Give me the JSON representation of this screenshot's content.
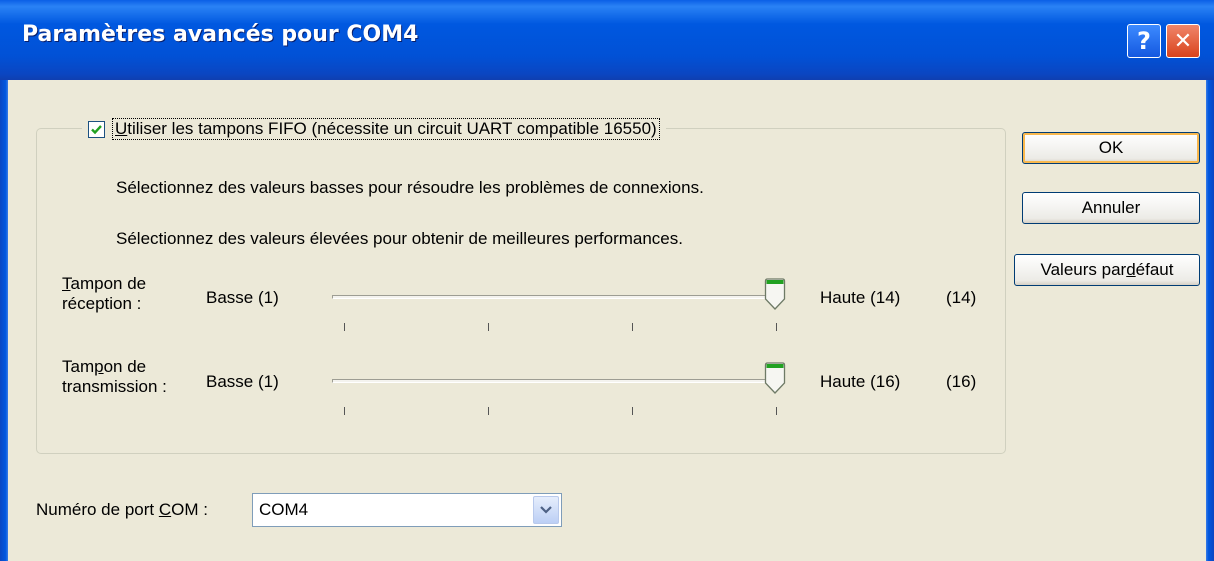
{
  "window": {
    "title": "Paramètres avancés pour COM4",
    "help_glyph": "?",
    "close_glyph": "✕"
  },
  "fifo": {
    "checked": true,
    "label": "Utiliser les tampons FIFO (nécessite un circuit UART compatible 16550)",
    "hint_low": "Sélectionnez des valeurs basses pour résoudre les problèmes de connexions.",
    "hint_high": "Sélectionnez des valeurs élevées pour obtenir de meilleures performances."
  },
  "receive": {
    "label_line1": "Tampon de",
    "label_line2": "réception :",
    "min_label": "Basse (1)",
    "max_label": "Haute (14)",
    "current": "(14)",
    "value": 14,
    "min": 1,
    "max": 14
  },
  "transmit": {
    "label_line1": "Tampon de",
    "label_line2": "transmission :",
    "min_label": "Basse (1)",
    "max_label": "Haute (16)",
    "current": "(16)",
    "value": 16,
    "min": 1,
    "max": 16
  },
  "buttons": {
    "ok": "OK",
    "cancel": "Annuler",
    "defaults": "Valeurs par défaut"
  },
  "port": {
    "label": "Numéro de port COM :",
    "value": "COM4"
  },
  "icons": {
    "checkbox": "checkmark-icon",
    "slider_thumb": "slider-thumb-icon",
    "dropdown": "chevron-down-icon"
  },
  "colors": {
    "titlebar": "#0058e0",
    "dialog_bg": "#ece9d8",
    "close_button": "#d9431c",
    "default_button_highlight": "#f8b84e",
    "thumb_green": "#21a121"
  }
}
